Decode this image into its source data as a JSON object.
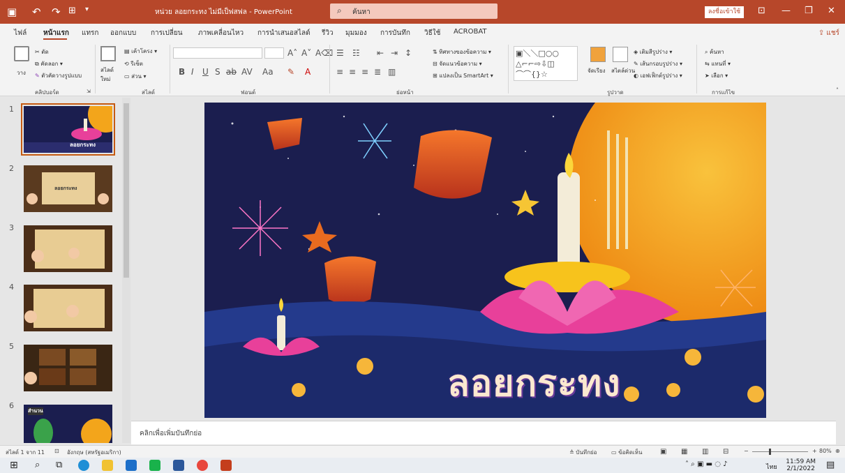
{
  "window": {
    "title": "หน่วย ลอยกระทง ไม่มีเป็ฟสฟล - PowerPoint",
    "search_placeholder": "ค้นหา",
    "signin_label": "ลงชื่อเข้าใช้"
  },
  "menu": {
    "tabs": [
      "ไฟล์",
      "หน้าแรก",
      "แทรก",
      "ออกแบบ",
      "การเปลี่ยน",
      "ภาพเคลื่อนไหว",
      "การนำเสนอสไลด์",
      "รีวิว",
      "มุมมอง",
      "การบันทึก",
      "วิธีใช้",
      "ACROBAT"
    ],
    "active_index": 1,
    "share_label": "แชร์"
  },
  "ribbon": {
    "clipboard": {
      "paste": "วาง",
      "cut": "ตัด",
      "copy": "คัดลอก",
      "format_painter": "ตัวคัดวางรูปแบบ",
      "label": "คลิปบอร์ด"
    },
    "slides": {
      "new_slide": "สไลด์ใหม่",
      "layout": "เค้าโครง",
      "reset": "รีเซ็ต",
      "section": "ส่วน",
      "label": "สไลด์"
    },
    "font": {
      "label": "ฟอนต์"
    },
    "paragraph": {
      "text_direction": "ทิศทางของข้อความ",
      "align_text": "จัดแนวข้อความ",
      "smartart": "แปลงเป็น SmartArt",
      "label": "ย่อหน้า"
    },
    "drawing": {
      "arrange": "จัดเรียง",
      "quick_styles": "สไตล์ด่วน",
      "fill": "เติมสีรูปร่าง",
      "outline": "เส้นกรอบรูปร่าง",
      "effects": "เอฟเฟ็กต์รูปร่าง",
      "label": "รูปวาด"
    },
    "editing": {
      "find": "ค้นหา",
      "replace": "แทนที่",
      "select": "เลือก",
      "label": "การแก้ไข"
    }
  },
  "slides": [
    {
      "num": "1",
      "caption": "ลอยกระทง"
    },
    {
      "num": "2",
      "caption": "ลอยกระทง"
    },
    {
      "num": "3",
      "caption": ""
    },
    {
      "num": "4",
      "caption": ""
    },
    {
      "num": "5",
      "caption": ""
    },
    {
      "num": "6",
      "caption": "สำนวน"
    }
  ],
  "main_slide": {
    "title_text": "ลอยกระทง"
  },
  "notes_placeholder": "คลิกเพื่อเพิ่มบันทึกย่อ",
  "status": {
    "slide_count": "สไลด์ 1 จาก 11",
    "language": "อังกฤษ (สหรัฐอเมริกา)",
    "notes": "บันทึกย่อ",
    "comments": "ข้อคิดเห็น",
    "zoom": "80%"
  },
  "taskbar": {
    "time": "11:59 AM",
    "date": "2/1/2022",
    "lang": "ไทย"
  },
  "colors": {
    "accent": "#b7472a",
    "slide_bg": "#1b1e4f",
    "moon": "#f3a51b",
    "lotus": "#e8409a"
  }
}
